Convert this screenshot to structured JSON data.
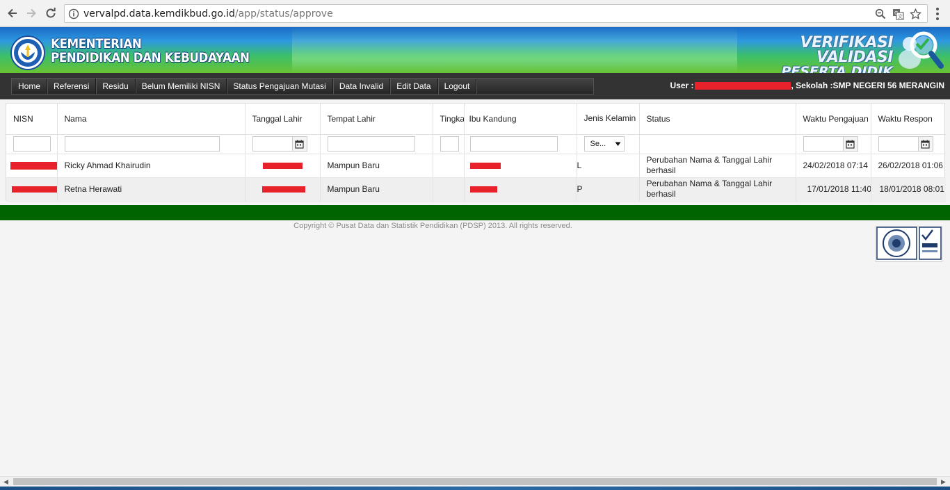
{
  "browser": {
    "url_host": "vervalpd.data.kemdikbud.go.id",
    "url_path": "/app/status/approve"
  },
  "header": {
    "ministry_line1": "KEMENTERIAN",
    "ministry_line2": "PENDIDIKAN DAN KEBUDAYAAN",
    "app_line1": "VERIFIKASI VALIDASI",
    "app_line2": "PESERTA DIDIK"
  },
  "nav": {
    "items": [
      "Home",
      "Referensi",
      "Residu",
      "Belum Memiliki NISN",
      "Status Pengajuan Mutasi",
      "Data Invalid",
      "Edit Data",
      "Logout"
    ],
    "user_label": "User :",
    "school_label": ", Sekolah :SMP NEGERI 56 MERANGIN"
  },
  "grid": {
    "columns": [
      "NISN",
      "Nama",
      "Tanggal Lahir",
      "Tempat Lahir",
      "Tingkat",
      "Ibu Kandung",
      "Jenis Kelamin",
      "Status",
      "Waktu Pengajuan",
      "Waktu Respon"
    ],
    "gender_filter_value": "Se...",
    "rows": [
      {
        "nama": "Ricky Ahmad Khairudin",
        "tempat_lahir": "Mampun Baru",
        "tingkat": "",
        "jenis_kelamin": "L",
        "status": "Perubahan Nama & Tanggal Lahir berhasil",
        "waktu_pengajuan": "24/02/2018 07:14",
        "waktu_respon": "26/02/2018 01:06"
      },
      {
        "nama": "Retna Herawati",
        "tempat_lahir": "Mampun Baru",
        "tingkat": "",
        "jenis_kelamin": "P",
        "status": "Perubahan Nama & Tanggal Lahir berhasil",
        "waktu_pengajuan": "17/01/2018 11:40",
        "waktu_respon": "18/01/2018 08:01"
      }
    ]
  },
  "footer": {
    "copyright": "Copyright © Pusat Data dan Statistik Pendidikan (PDSP) 2013. All rights reserved."
  },
  "colors": {
    "nav_bg": "#333333",
    "footer_green": "#006400",
    "redaction": "#e8222a"
  }
}
